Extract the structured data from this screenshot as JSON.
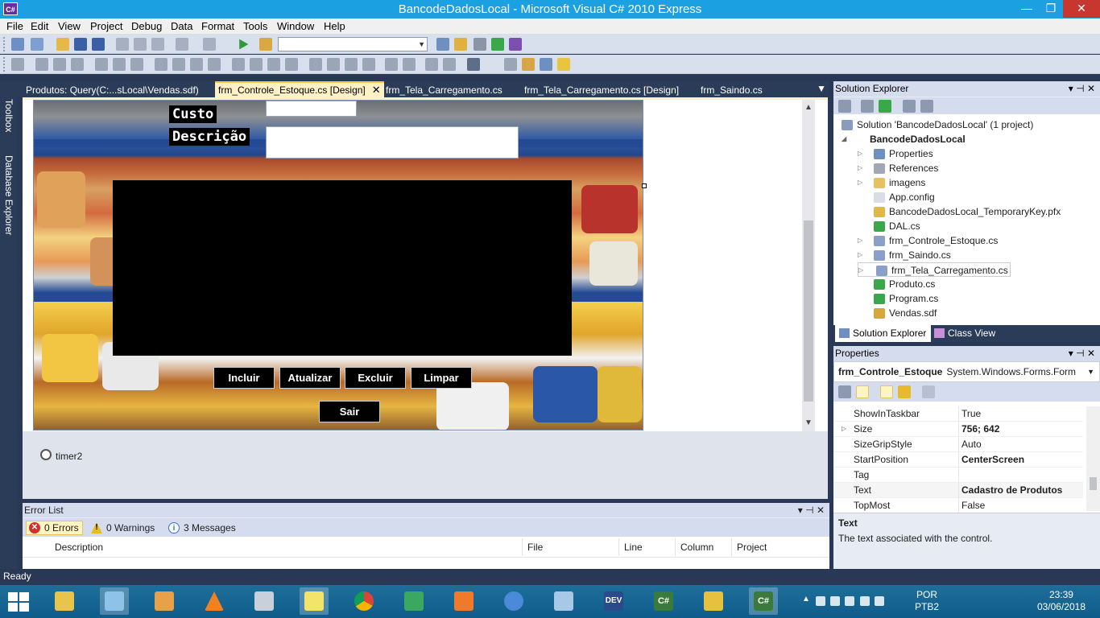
{
  "window": {
    "title": "BancodeDadosLocal - Microsoft Visual C# 2010 Express",
    "app_icon_text": "C#",
    "minimize": "—",
    "restore": "❐",
    "close": "✕"
  },
  "menu": [
    "File",
    "Edit",
    "View",
    "Project",
    "Debug",
    "Data",
    "Format",
    "Tools",
    "Window",
    "Help"
  ],
  "side_tabs": {
    "toolbox": "Toolbox",
    "database_explorer": "Database Explorer"
  },
  "doc_tabs": [
    {
      "label": "Produtos: Query(C:...sLocal\\Vendas.sdf)"
    },
    {
      "label": "frm_Controle_Estoque.cs [Design]",
      "close": "✕"
    },
    {
      "label": "frm_Tela_Carregamento.cs"
    },
    {
      "label": "frm_Tela_Carregamento.cs [Design]"
    },
    {
      "label": "frm_Saindo.cs"
    }
  ],
  "tab_menu_icon": "▼",
  "form": {
    "label_custo": "Custo",
    "label_descricao": "Descrição",
    "buttons": {
      "incluir": "Incluir",
      "atualizar": "Atualizar",
      "excluir": "Excluir",
      "limpar": "Limpar",
      "sair": "Sair"
    }
  },
  "component_tray": {
    "timer": "timer2"
  },
  "error_list": {
    "title": "Error List",
    "controls": "▾ ⊣ ✕",
    "errors": "0 Errors",
    "warnings": "0 Warnings",
    "messages": "3 Messages",
    "columns": [
      "Description",
      "File",
      "Line",
      "Column",
      "Project"
    ]
  },
  "solution_explorer": {
    "title": "Solution Explorer",
    "controls": "▾ ⊣ ✕",
    "solution": "Solution 'BancodeDadosLocal' (1 project)",
    "project": "BancodeDadosLocal",
    "items": [
      "Properties",
      "References",
      "imagens",
      "App.config",
      "BancodeDadosLocal_TemporaryKey.pfx",
      "DAL.cs",
      "frm_Controle_Estoque.cs",
      "frm_Saindo.cs",
      "frm_Tela_Carregamento.cs",
      "Produto.cs",
      "Program.cs",
      "Vendas.sdf"
    ],
    "tabs": [
      "Solution Explorer",
      "Class View"
    ]
  },
  "properties": {
    "title": "Properties",
    "controls": "▾ ⊣ ✕",
    "object_name": "frm_Controle_Estoque",
    "object_type": "System.Windows.Forms.Form",
    "rows": [
      {
        "key": "ShowInTaskbar",
        "value": "True"
      },
      {
        "key": "Size",
        "value": "756; 642"
      },
      {
        "key": "SizeGripStyle",
        "value": "Auto"
      },
      {
        "key": "StartPosition",
        "value": "CenterScreen"
      },
      {
        "key": "Tag",
        "value": ""
      },
      {
        "key": "Text",
        "value": "Cadastro de Produtos"
      },
      {
        "key": "TopMost",
        "value": "False"
      }
    ],
    "desc_title": "Text",
    "desc_text": "The text associated with the control."
  },
  "status": {
    "text": "Ready"
  },
  "taskbar": {
    "language": "POR",
    "keyboard": "PTB2",
    "time": "23:39",
    "date": "03/06/2018",
    "dev_label": "DEV",
    "cs_label": "C#"
  }
}
